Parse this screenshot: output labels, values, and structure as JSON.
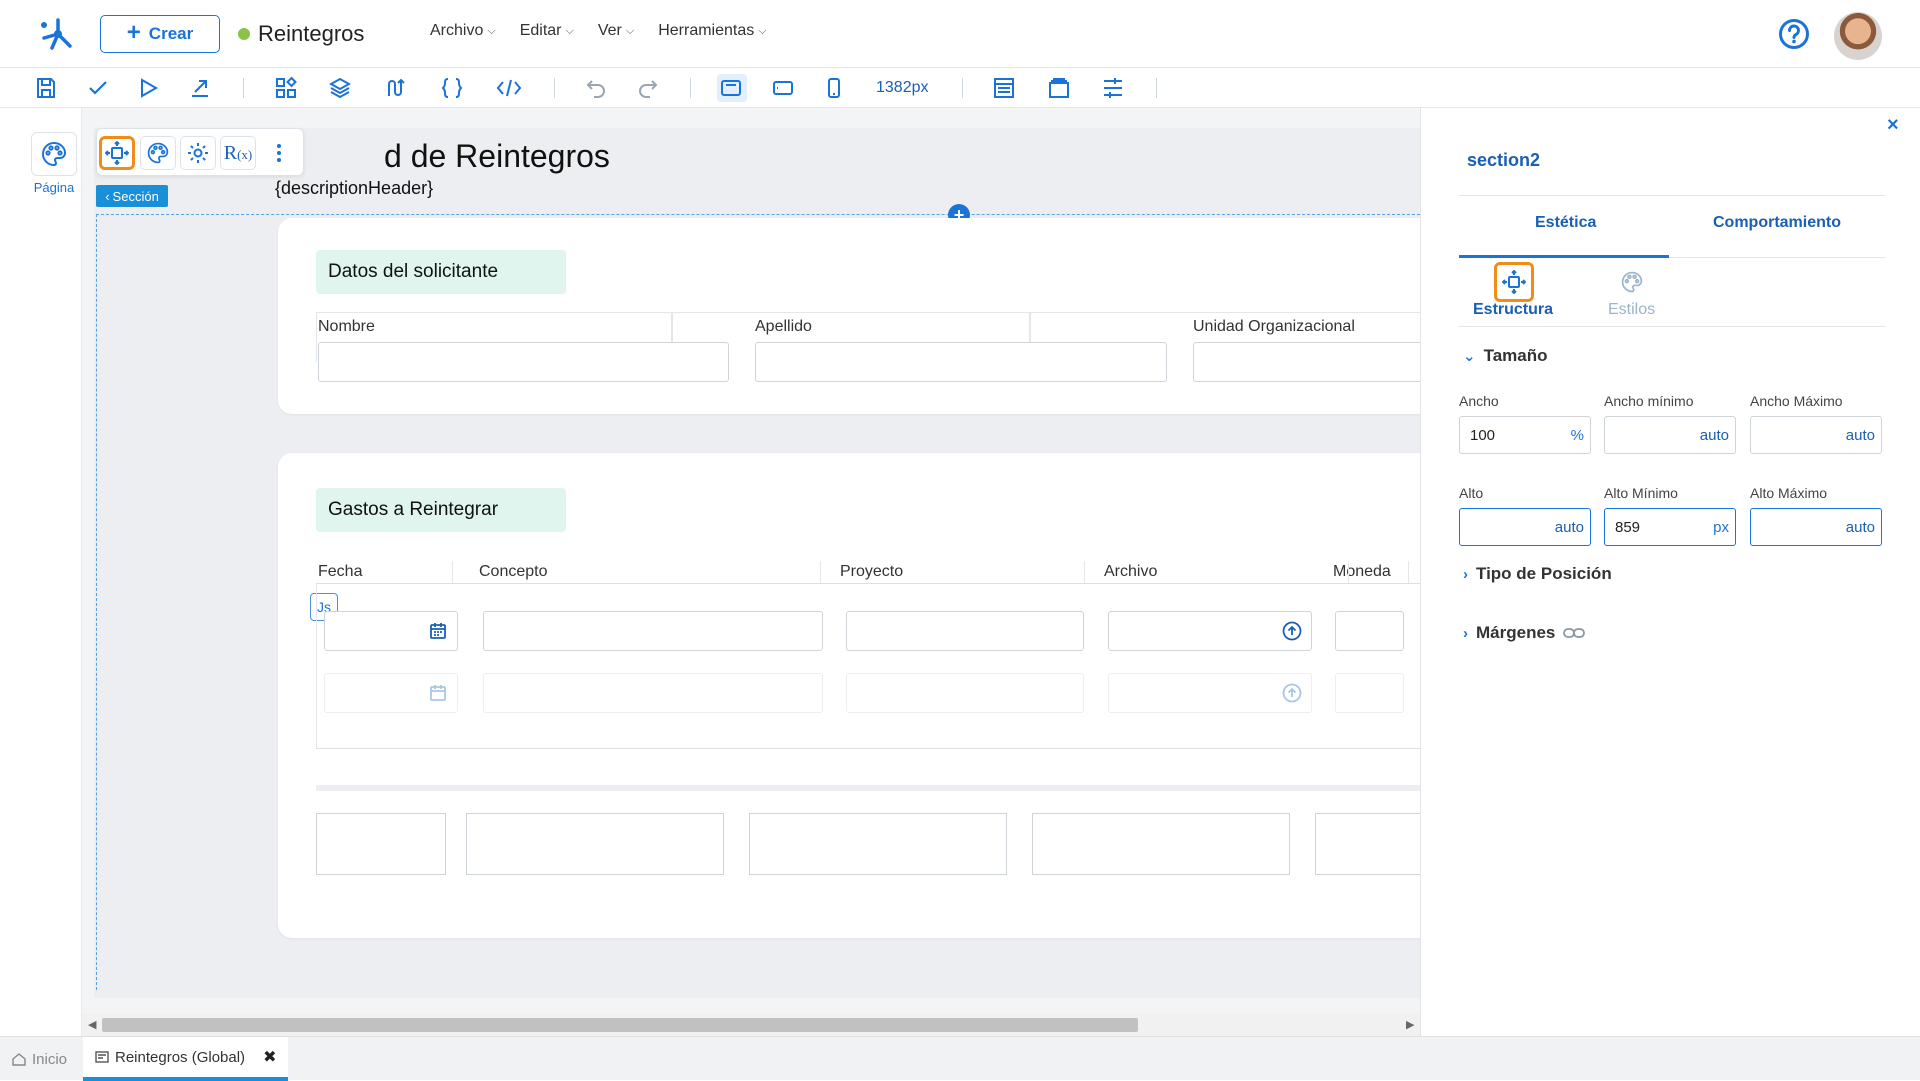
{
  "header": {
    "create_label": "Crear",
    "app_title": "Reintegros",
    "status_color": "#8bc34a",
    "menu": [
      "Archivo",
      "Editar",
      "Ver",
      "Herramientas"
    ]
  },
  "toolbar": {
    "width_readout": "1382px",
    "accent": "#1a73d9"
  },
  "rail": {
    "page_label": "Página"
  },
  "canvas": {
    "page_title": "d de Reintegros",
    "page_description": "{descriptionHeader}",
    "section_tag": "Sección",
    "js_badge": "Js",
    "card1": {
      "title": "Datos del solicitante",
      "fields": [
        "Nombre",
        "Apellido",
        "Unidad Organizacional"
      ]
    },
    "card2": {
      "title": "Gastos a Reintegrar",
      "columns": [
        "Fecha",
        "Concepto",
        "Proyecto",
        "Archivo",
        "Moneda"
      ]
    }
  },
  "panel": {
    "component_name": "section2",
    "tabs": [
      "Estética",
      "Comportamiento"
    ],
    "subtabs": [
      "Estructura",
      "Estilos"
    ],
    "sections": {
      "size": "Tamaño",
      "position": "Tipo de Posición",
      "margins": "Márgenes"
    },
    "size_fields": {
      "width_label": "Ancho",
      "width_value": "100",
      "width_unit": "%",
      "min_width_label": "Ancho mínimo",
      "min_width_value": "auto",
      "max_width_label": "Ancho Máximo",
      "max_width_value": "auto",
      "height_label": "Alto",
      "height_value": "auto",
      "min_height_label": "Alto Mínimo",
      "min_height_value": "859",
      "min_height_unit": "px",
      "max_height_label": "Alto Máximo",
      "max_height_value": "auto"
    }
  },
  "bottom_tabs": {
    "home": "Inicio",
    "current": "Reintegros (Global)"
  }
}
